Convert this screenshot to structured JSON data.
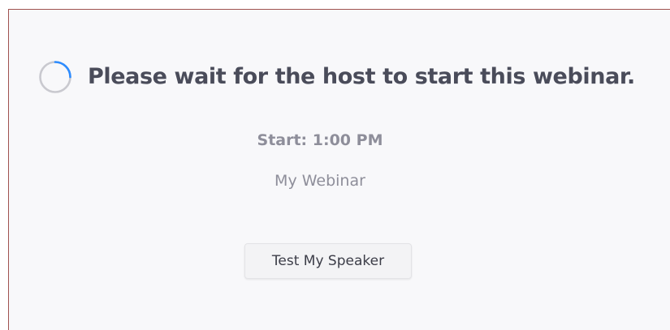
{
  "waiting": {
    "title": "Please wait for the host to start this webinar.",
    "start_time": "Start: 1:00 PM",
    "webinar_name": "My Webinar"
  },
  "actions": {
    "test_speaker_label": "Test My Speaker"
  },
  "icons": {
    "spinner": "loading-spinner-icon"
  },
  "colors": {
    "spinner_track": "#c9c9cf",
    "spinner_accent": "#2d8cff",
    "title": "#4a4c5a",
    "secondary_text": "#8e8e9a",
    "frame_border": "#a0524f"
  }
}
